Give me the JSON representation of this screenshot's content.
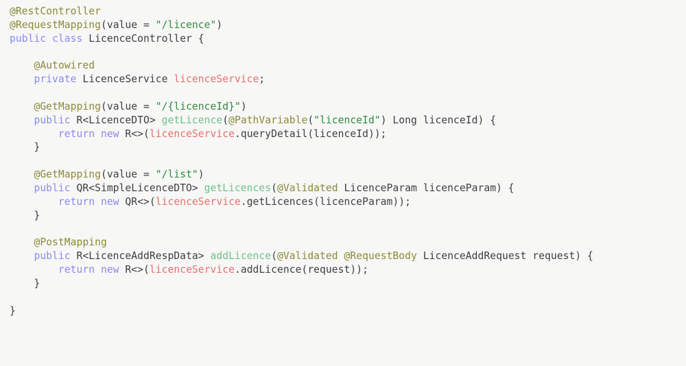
{
  "editor": {
    "file_name": "LicenceController.java",
    "language": "Java",
    "background_color": "#f7f7f6",
    "theme": "light",
    "font_size_px": 14.7,
    "palette": {
      "plain": "#3c3f41",
      "annotation": "#8a8a39",
      "keyword": "#8a8aee",
      "string": "#2e8b40",
      "method_declaration": "#6fc08b",
      "field_reference": "#e4726e"
    }
  },
  "code": {
    "lines": [
      {
        "n": 1,
        "text": "@RestController",
        "tokens": [
          {
            "t": "@RestController",
            "c": "annotation"
          }
        ]
      },
      {
        "n": 2,
        "text": "@RequestMapping(value = \"/licence\")",
        "tokens": [
          {
            "t": "@RequestMapping",
            "c": "annotation"
          },
          {
            "t": "(",
            "c": "plain"
          },
          {
            "t": "value",
            "c": "plain"
          },
          {
            "t": " = ",
            "c": "plain"
          },
          {
            "t": "\"/licence\"",
            "c": "string"
          },
          {
            "t": ")",
            "c": "plain"
          }
        ]
      },
      {
        "n": 3,
        "text": "public class LicenceController {",
        "tokens": [
          {
            "t": "public",
            "c": "keyword"
          },
          {
            "t": " ",
            "c": "plain"
          },
          {
            "t": "class",
            "c": "keyword"
          },
          {
            "t": " LicenceController {",
            "c": "plain"
          }
        ]
      },
      {
        "n": 4,
        "text": "",
        "tokens": []
      },
      {
        "n": 5,
        "text": "    @Autowired",
        "tokens": [
          {
            "t": "    ",
            "c": "plain"
          },
          {
            "t": "@Autowired",
            "c": "annotation"
          }
        ]
      },
      {
        "n": 6,
        "text": "    private LicenceService licenceService;",
        "tokens": [
          {
            "t": "    ",
            "c": "plain"
          },
          {
            "t": "private",
            "c": "keyword"
          },
          {
            "t": " LicenceService ",
            "c": "plain"
          },
          {
            "t": "licenceService",
            "c": "field"
          },
          {
            "t": ";",
            "c": "plain"
          }
        ]
      },
      {
        "n": 7,
        "text": "",
        "tokens": []
      },
      {
        "n": 8,
        "text": "    @GetMapping(value = \"/{licenceId}\")",
        "tokens": [
          {
            "t": "    ",
            "c": "plain"
          },
          {
            "t": "@GetMapping",
            "c": "annotation"
          },
          {
            "t": "(",
            "c": "plain"
          },
          {
            "t": "value",
            "c": "plain"
          },
          {
            "t": " = ",
            "c": "plain"
          },
          {
            "t": "\"/{licenceId}\"",
            "c": "string"
          },
          {
            "t": ")",
            "c": "plain"
          }
        ]
      },
      {
        "n": 9,
        "text": "    public R<LicenceDTO> getLicence(@PathVariable(\"licenceId\") Long licenceId) {",
        "tokens": [
          {
            "t": "    ",
            "c": "plain"
          },
          {
            "t": "public",
            "c": "keyword"
          },
          {
            "t": " R<LicenceDTO> ",
            "c": "plain"
          },
          {
            "t": "getLicence",
            "c": "method"
          },
          {
            "t": "(",
            "c": "plain"
          },
          {
            "t": "@PathVariable",
            "c": "annotation"
          },
          {
            "t": "(",
            "c": "plain"
          },
          {
            "t": "\"licenceId\"",
            "c": "string"
          },
          {
            "t": ") Long licenceId) {",
            "c": "plain"
          }
        ]
      },
      {
        "n": 10,
        "text": "        return new R<>(licenceService.queryDetail(licenceId));",
        "tokens": [
          {
            "t": "        ",
            "c": "plain"
          },
          {
            "t": "return",
            "c": "keyword"
          },
          {
            "t": " ",
            "c": "plain"
          },
          {
            "t": "new",
            "c": "keyword"
          },
          {
            "t": " R<>(",
            "c": "plain"
          },
          {
            "t": "licenceService",
            "c": "field"
          },
          {
            "t": ".queryDetail(licenceId));",
            "c": "plain"
          }
        ]
      },
      {
        "n": 11,
        "text": "    }",
        "tokens": [
          {
            "t": "    }",
            "c": "plain"
          }
        ]
      },
      {
        "n": 12,
        "text": "",
        "tokens": []
      },
      {
        "n": 13,
        "text": "    @GetMapping(value = \"/list\")",
        "tokens": [
          {
            "t": "    ",
            "c": "plain"
          },
          {
            "t": "@GetMapping",
            "c": "annotation"
          },
          {
            "t": "(",
            "c": "plain"
          },
          {
            "t": "value",
            "c": "plain"
          },
          {
            "t": " = ",
            "c": "plain"
          },
          {
            "t": "\"/list\"",
            "c": "string"
          },
          {
            "t": ")",
            "c": "plain"
          }
        ]
      },
      {
        "n": 14,
        "text": "    public QR<SimpleLicenceDTO> getLicences(@Validated LicenceParam licenceParam) {",
        "tokens": [
          {
            "t": "    ",
            "c": "plain"
          },
          {
            "t": "public",
            "c": "keyword"
          },
          {
            "t": " QR<SimpleLicenceDTO> ",
            "c": "plain"
          },
          {
            "t": "getLicences",
            "c": "method"
          },
          {
            "t": "(",
            "c": "plain"
          },
          {
            "t": "@Validated",
            "c": "annotation"
          },
          {
            "t": " LicenceParam licenceParam) {",
            "c": "plain"
          }
        ]
      },
      {
        "n": 15,
        "text": "        return new QR<>(licenceService.getLicences(licenceParam));",
        "tokens": [
          {
            "t": "        ",
            "c": "plain"
          },
          {
            "t": "return",
            "c": "keyword"
          },
          {
            "t": " ",
            "c": "plain"
          },
          {
            "t": "new",
            "c": "keyword"
          },
          {
            "t": " QR<>(",
            "c": "plain"
          },
          {
            "t": "licenceService",
            "c": "field"
          },
          {
            "t": ".getLicences(licenceParam));",
            "c": "plain"
          }
        ]
      },
      {
        "n": 16,
        "text": "    }",
        "tokens": [
          {
            "t": "    }",
            "c": "plain"
          }
        ]
      },
      {
        "n": 17,
        "text": "",
        "tokens": []
      },
      {
        "n": 18,
        "text": "    @PostMapping",
        "tokens": [
          {
            "t": "    ",
            "c": "plain"
          },
          {
            "t": "@PostMapping",
            "c": "annotation"
          }
        ]
      },
      {
        "n": 19,
        "text": "    public R<LicenceAddRespData> addLicence(@Validated @RequestBody LicenceAddRequest request) {",
        "tokens": [
          {
            "t": "    ",
            "c": "plain"
          },
          {
            "t": "public",
            "c": "keyword"
          },
          {
            "t": " R<LicenceAddRespData> ",
            "c": "plain"
          },
          {
            "t": "addLicence",
            "c": "method"
          },
          {
            "t": "(",
            "c": "plain"
          },
          {
            "t": "@Validated",
            "c": "annotation"
          },
          {
            "t": " ",
            "c": "plain"
          },
          {
            "t": "@RequestBody",
            "c": "annotation"
          },
          {
            "t": " LicenceAddRequest request) {",
            "c": "plain"
          }
        ]
      },
      {
        "n": 20,
        "text": "        return new R<>(licenceService.addLicence(request));",
        "tokens": [
          {
            "t": "        ",
            "c": "plain"
          },
          {
            "t": "return",
            "c": "keyword"
          },
          {
            "t": " ",
            "c": "plain"
          },
          {
            "t": "new",
            "c": "keyword"
          },
          {
            "t": " R<>(",
            "c": "plain"
          },
          {
            "t": "licenceService",
            "c": "field"
          },
          {
            "t": ".addLicence(request));",
            "c": "plain"
          }
        ]
      },
      {
        "n": 21,
        "text": "    }",
        "tokens": [
          {
            "t": "    }",
            "c": "plain"
          }
        ]
      },
      {
        "n": 22,
        "text": "",
        "tokens": []
      },
      {
        "n": 23,
        "text": "}",
        "tokens": [
          {
            "t": "}",
            "c": "plain"
          }
        ]
      }
    ]
  }
}
